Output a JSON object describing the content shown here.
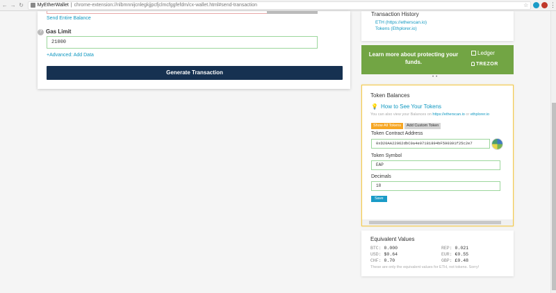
{
  "browser": {
    "site_name": "MyEtherWallet",
    "url": "chrome-extension://nlbmnnijcnlegkjjpcfjclmcfggfefdm/cx-wallet.html#send-transaction"
  },
  "send": {
    "send_entire_label": "Send Entire Balance",
    "gas_limit_label": "Gas Limit",
    "gas_limit_value": "21000",
    "advanced_label": "+Advanced: Add Data",
    "generate_label": "Generate Transaction"
  },
  "history": {
    "title": "Transaction History",
    "eth_link": "ETH (https://etherscan.io)",
    "tokens_link": "Tokens (Ethplorer.io)"
  },
  "banner": {
    "text": "Learn more about protecting your funds.",
    "ledger": "Ledger",
    "trezor": "TREZOR"
  },
  "tokens": {
    "title": "Token Balances",
    "howto": "How to See Your Tokens",
    "info_text": "You can also view your Balances on",
    "info_link1": "https://etherscan.io",
    "info_or": "or",
    "info_link2": "ethplorer.io",
    "show_all": "Show All Tokens",
    "add_custom": "Add Custom Token",
    "contract_label": "Token Contract Address",
    "contract_value": "0xD20AA22062dbC0a4e07181894bF590391f25c2e7",
    "symbol_label": "Token Symbol",
    "symbol_value": "EAP",
    "decimals_label": "Decimals",
    "decimals_value": "18",
    "save": "Save"
  },
  "equivalent": {
    "title": "Equivalent Values",
    "btc_label": "BTC:",
    "btc_value": "0.000",
    "usd_label": "USD:",
    "usd_value": "$0.64",
    "chf_label": "CHF:",
    "chf_value": "0.70",
    "rep_label": "REP:",
    "rep_value": "0.021",
    "eur_label": "EUR:",
    "eur_value": "€0.55",
    "gbp_label": "GBP:",
    "gbp_value": "£0.48",
    "note": "These are only the equivalent values for ETH, not tokens. Sorry!"
  },
  "colors": {
    "accent": "#0e97c0",
    "primary_button": "#163151",
    "banner": "#72a544",
    "highlight_border": "#f2c94c"
  }
}
